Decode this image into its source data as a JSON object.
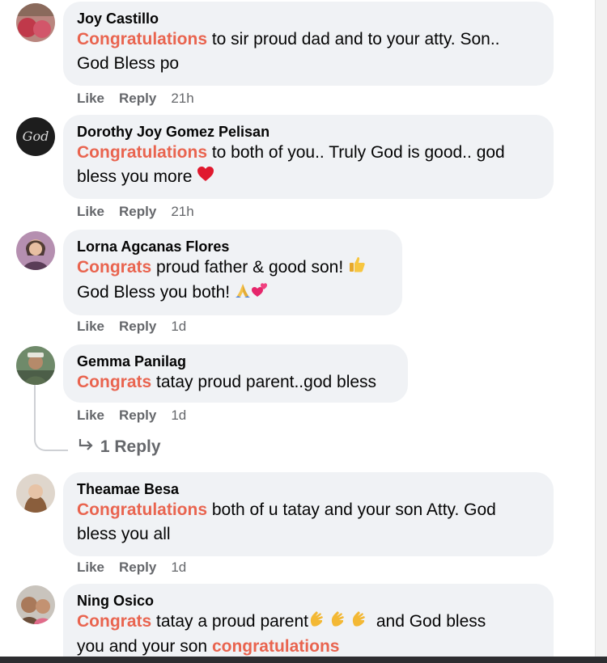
{
  "comments": [
    {
      "author": "Joy Castillo",
      "highlight": "Congratulations",
      "text_line1": " to sir proud dad and to your atty. Son..",
      "text_line2": "God Bless po",
      "like": "Like",
      "reply": "Reply",
      "time": "21h"
    },
    {
      "author": "Dorothy Joy Gomez Pelisan",
      "highlight": "Congratulations",
      "text_line1": " to both of you.. Truly God is good.. god",
      "text_line2": "bless you more",
      "like": "Like",
      "reply": "Reply",
      "time": "21h"
    },
    {
      "author": "Lorna Agcanas Flores",
      "highlight": "Congrats",
      "text_line1": " proud father & good son!",
      "text_line2": "God Bless you both!",
      "like": "Like",
      "reply": "Reply",
      "time": "1d"
    },
    {
      "author": "Gemma Panilag",
      "highlight": "Congrats",
      "text_line1": " tatay proud parent..god bless",
      "like": "Like",
      "reply": "Reply",
      "time": "1d",
      "replies_label": "1 Reply"
    },
    {
      "author": "Theamae Besa",
      "highlight": "Congratulations",
      "text_line1": " both of u tatay and your son Atty. God",
      "text_line2": "bless you all",
      "like": "Like",
      "reply": "Reply",
      "time": "1d"
    },
    {
      "author": "Ning Osico",
      "highlight": "Congrats",
      "text_line1": " tatay a proud parent",
      "text_line1b": " and God bless",
      "text_line2": "you and your son ",
      "highlight2": "congratulations"
    }
  ],
  "icons": [
    "avatar-photo",
    "heart-emoji",
    "thumbs-up-emoji",
    "praying-hands-emoji",
    "two-hearts-emoji",
    "clapping-hands-emoji",
    "reply-arrow-icon"
  ],
  "colors": {
    "highlight": "#e9644f",
    "bubble": "#f0f2f5",
    "meta": "#65676b"
  }
}
